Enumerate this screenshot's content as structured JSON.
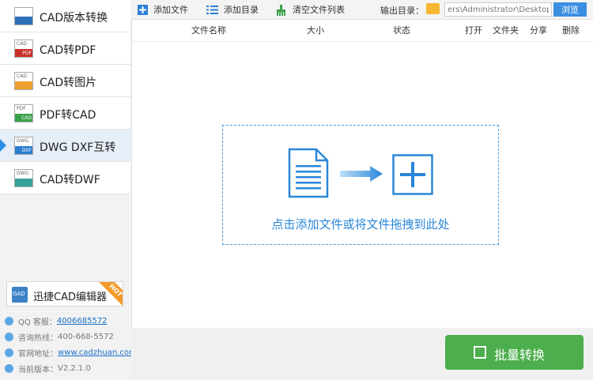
{
  "sidebar": {
    "items": [
      {
        "label": "CAD版本转换",
        "tag": "",
        "tag2": "",
        "band": "#2d6fb8",
        "active": false
      },
      {
        "label": "CAD转PDF",
        "tag": "CAD",
        "tag2": "PDF",
        "band": "#c9302c",
        "active": false
      },
      {
        "label": "CAD转图片",
        "tag": "CAD",
        "tag2": "",
        "band": "#f0a030",
        "active": false
      },
      {
        "label": "PDF转CAD",
        "tag": "PDF",
        "tag2": "CAD",
        "band": "#3aa14a",
        "active": false
      },
      {
        "label": "DWG DXF互转",
        "tag": "DWG",
        "tag2": "DXF",
        "band": "#2d7fd0",
        "active": true
      },
      {
        "label": "CAD转DWF",
        "tag": "DWG",
        "tag2": "",
        "band": "#3aa19a",
        "active": false
      }
    ],
    "editor": {
      "label": "迅捷CAD编辑器",
      "icon_text": "GAD",
      "badge": "HOT"
    },
    "info": [
      {
        "label": "QQ 客服：",
        "value": "4006685572",
        "link": true
      },
      {
        "label": "咨询热线：",
        "value": "400-668-5572",
        "link": false
      },
      {
        "label": "官网地址：",
        "value": "www.cadzhuan.com",
        "link": true
      },
      {
        "label": "当前版本：",
        "value": "V2.2.1.0",
        "link": false
      }
    ]
  },
  "toolbar": {
    "add_file": "添加文件",
    "add_dir": "添加目录",
    "clear_list": "清空文件列表",
    "output_label": "输出目录：",
    "output_path": "ers\\Administrator\\Desktop",
    "browse": "浏览"
  },
  "columns": {
    "name": "文件名称",
    "size": "大小",
    "status": "状态",
    "open": "打开",
    "folder": "文件夹",
    "share": "分享",
    "delete": "删除"
  },
  "dropzone": {
    "text": "点击添加文件或将文件拖拽到此处"
  },
  "batch": {
    "label": "批量转换"
  },
  "colors": {
    "accent": "#2a86d8",
    "green": "#4cae4c"
  }
}
